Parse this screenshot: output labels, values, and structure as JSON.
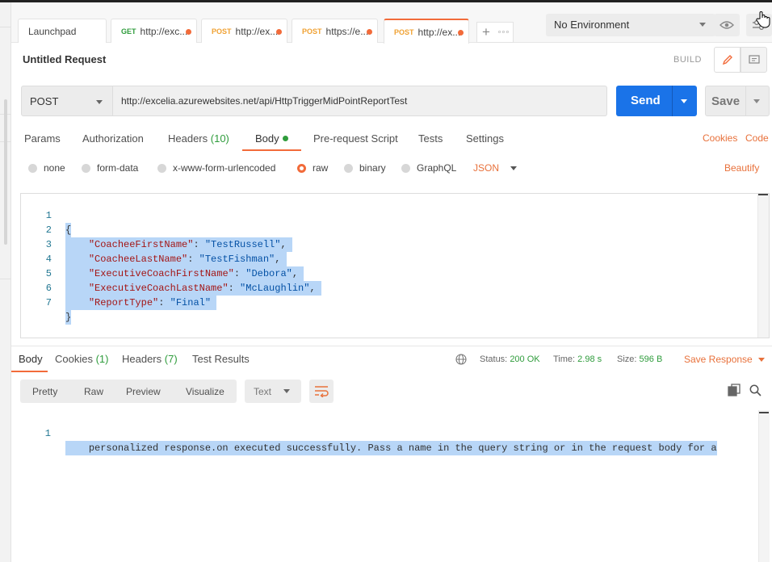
{
  "tabs": [
    {
      "method": "",
      "label": "Launchpad"
    },
    {
      "method": "GET",
      "label": "http://exc..."
    },
    {
      "method": "POST",
      "label": "http://ex..."
    },
    {
      "method": "POST",
      "label": "https://e..."
    },
    {
      "method": "POST",
      "label": "http://ex..."
    }
  ],
  "environment": {
    "selected": "No Environment"
  },
  "request": {
    "title": "Untitled Request",
    "build_label": "BUILD",
    "method": "POST",
    "url": "http://excelia.azurewebsites.net/api/HttpTriggerMidPointReportTest",
    "send_label": "Send",
    "save_label": "Save"
  },
  "request_tabs": {
    "params": "Params",
    "authorization": "Authorization",
    "headers": "Headers",
    "headers_count": "(10)",
    "body": "Body",
    "pre_request": "Pre-request Script",
    "tests": "Tests",
    "settings": "Settings",
    "cookies": "Cookies",
    "code": "Code"
  },
  "body_types": {
    "none": "none",
    "form_data": "form-data",
    "urlencoded": "x-www-form-urlencoded",
    "raw": "raw",
    "binary": "binary",
    "graphql": "GraphQL",
    "format": "JSON",
    "beautify": "Beautify"
  },
  "editor": {
    "lines": [
      {
        "n": "1",
        "open": "{"
      },
      {
        "n": "2",
        "key": "\"CoacheeFirstName\"",
        "value": "\"TestRussell\"",
        "trail": ","
      },
      {
        "n": "3",
        "key": "\"CoacheeLastName\"",
        "value": "\"TestFishman\"",
        "trail": ","
      },
      {
        "n": "4",
        "key": "\"ExecutiveCoachFirstName\"",
        "value": "\"Debora\"",
        "trail": ","
      },
      {
        "n": "5",
        "key": "\"ExecutiveCoachLastName\"",
        "value": "\"McLaughlin\"",
        "trail": ","
      },
      {
        "n": "6",
        "key": "\"ReportType\"",
        "value": "\"Final\"",
        "trail": ""
      },
      {
        "n": "7",
        "open": "}"
      }
    ],
    "colon": ": "
  },
  "response": {
    "tabs": {
      "body": "Body",
      "cookies": "Cookies",
      "cookies_count": "(1)",
      "headers": "Headers",
      "headers_count": "(7)",
      "test_results": "Test Results"
    },
    "status_label": "Status:",
    "status_value": "200 OK",
    "time_label": "Time:",
    "time_value": "2.98 s",
    "size_label": "Size:",
    "size_value": "596 B",
    "save_response": "Save Response",
    "views": {
      "pretty": "Pretty",
      "raw": "Raw",
      "preview": "Preview",
      "visualize": "Visualize",
      "format": "Text"
    },
    "body_line_number": "1",
    "body_line_1": "This HTTP triggered function executed successfully. Pass a name in the query string or in the request body for a",
    "body_line_2": "personalized response."
  },
  "colors": {
    "accent": "#f26b3a",
    "primary": "#1a73e8",
    "success": "#2f9c3c"
  }
}
